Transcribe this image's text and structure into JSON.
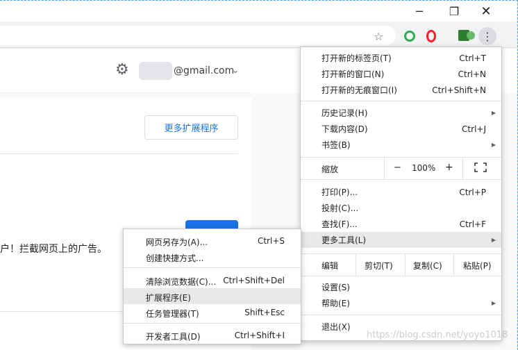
{
  "window": {
    "minimize": "─",
    "maximize": "❐",
    "close": "✕"
  },
  "toolbar": {
    "star": "☆",
    "menu": "⋮"
  },
  "account": {
    "email": "@gmail.com"
  },
  "page": {
    "more_extensions_button": "更多扩展程序",
    "description": "户！拦截网页上的广告。"
  },
  "menu": {
    "new_tab": {
      "label": "打开新的标签页(T)",
      "shortcut": "Ctrl+T"
    },
    "new_window": {
      "label": "打开新的窗口(N)",
      "shortcut": "Ctrl+N"
    },
    "new_incognito": {
      "label": "打开新的无痕窗口(I)",
      "shortcut": "Ctrl+Shift+N"
    },
    "history": {
      "label": "历史记录(H)"
    },
    "downloads": {
      "label": "下载内容(D)",
      "shortcut": "Ctrl+J"
    },
    "bookmarks": {
      "label": "书签(B)"
    },
    "zoom": {
      "label": "缩放",
      "minus": "−",
      "value": "100%",
      "plus": "+"
    },
    "print": {
      "label": "打印(P)...",
      "shortcut": "Ctrl+P"
    },
    "cast": {
      "label": "投射(C)..."
    },
    "find": {
      "label": "查找(F)...",
      "shortcut": "Ctrl+F"
    },
    "more_tools": {
      "label": "更多工具(L)"
    },
    "edit": {
      "label": "编辑",
      "cut": "剪切(T)",
      "copy": "复制(C)",
      "paste": "粘贴(P)"
    },
    "settings": {
      "label": "设置(S)"
    },
    "help": {
      "label": "帮助(E)"
    },
    "exit": {
      "label": "退出(X)"
    }
  },
  "submenu": {
    "save_page": {
      "label": "网页另存为(A)...",
      "shortcut": "Ctrl+S"
    },
    "create_shortcut": {
      "label": "创建快捷方式..."
    },
    "clear_data": {
      "label": "清除浏览数据(C)...",
      "shortcut": "Ctrl+Shift+Del"
    },
    "extensions": {
      "label": "扩展程序(E)"
    },
    "task_manager": {
      "label": "任务管理器(T)",
      "shortcut": "Shift+Esc"
    },
    "dev_tools": {
      "label": "开发者工具(D)",
      "shortcut": "Ctrl+Shift+I"
    }
  },
  "watermark": "https://blog.csdn.net/yoyo1018"
}
